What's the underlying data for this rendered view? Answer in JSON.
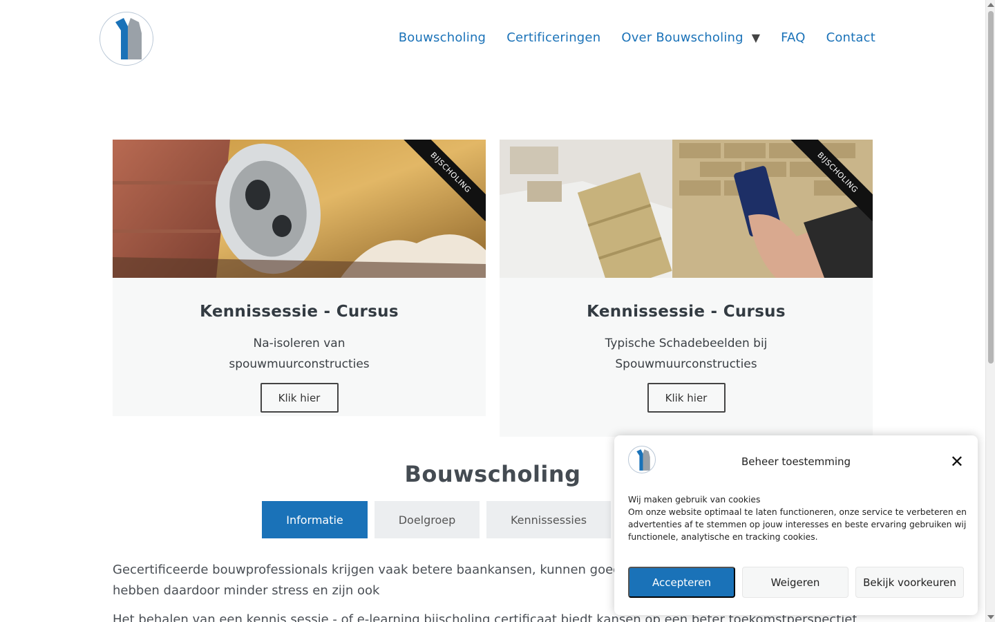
{
  "nav": {
    "items": [
      "Bouwscholing",
      "Certificeringen",
      "Over Bouwscholing",
      "FAQ",
      "Contact"
    ],
    "dropdown_icon": "triangle-down-icon"
  },
  "cards": [
    {
      "ribbon": "BIJSCHOLING",
      "title": "Kennissessie - Cursus",
      "subtitle": "Na-isoleren van spouwmuurconstructies",
      "button": "Klik hier"
    },
    {
      "ribbon": "BIJSCHOLING",
      "title": "Kennissessie - Cursus",
      "subtitle": "Typische Schadebeelden bij Spouwmuurconstructies",
      "button": "Klik hier"
    }
  ],
  "section": {
    "title": "Bouwscholing",
    "tabs": [
      "Informatie",
      "Doelgroep",
      "Kennissessies"
    ],
    "active_tab": "Informatie",
    "paragraph_1": "Gecertificeerde bouwprofessionals krijgen vaak betere baankansen, kunnen goed resultaten binnen normale tijdsduur, hebben daardoor minder stress en zijn ook",
    "paragraph_2": "Het behalen van een kennis sessie - of e-learning bijscholing certificaat biedt kansen op een beter toekomstperspectief"
  },
  "consent": {
    "title": "Beheer toestemming",
    "heading": "Wij maken gebruik van cookies",
    "text": "Om onze website optimaal te laten functioneren, onze service te verbeteren en advertenties af te stemmen op jouw interesses en beste ervaring gebruiken wij functionele, analytische en tracking cookies.",
    "accept": "Accepteren",
    "deny": "Weigeren",
    "preferences": "Bekijk voorkeuren",
    "close_icon": "close-icon"
  },
  "colors": {
    "accent": "#1a72b8",
    "card_bg": "#f7f8f8",
    "tab_bg": "#eceef0"
  }
}
